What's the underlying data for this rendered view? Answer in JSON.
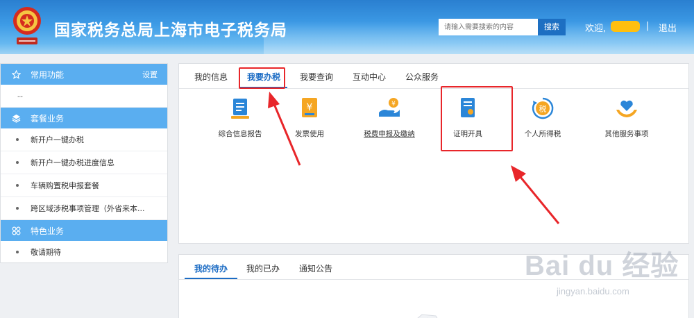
{
  "header": {
    "title": "国家税务总局上海市电子税务局",
    "search_placeholder": "请输入需要搜索的内容",
    "search_label": "搜索",
    "welcome": "欢迎,",
    "separator": "|",
    "logout": "退出"
  },
  "sidebar": {
    "common": {
      "label": "常用功能",
      "setting": "设置",
      "icon": "star-icon"
    },
    "common_empty": "--",
    "package": {
      "label": "套餐业务",
      "icon": "layers-icon"
    },
    "package_items": [
      {
        "label": "新开户一键办税"
      },
      {
        "label": "新开户一键办税进度信息"
      },
      {
        "label": "车辆购置税申报套餐"
      },
      {
        "label": "跨区域涉税事项管理（外省来本..."
      }
    ],
    "special": {
      "label": "特色业务",
      "icon": "grid-icon"
    },
    "special_items": [
      {
        "label": "敬请期待"
      }
    ]
  },
  "main": {
    "tabs": [
      {
        "label": "我的信息"
      },
      {
        "label": "我要办税",
        "active": true
      },
      {
        "label": "我要查询"
      },
      {
        "label": "互动中心"
      },
      {
        "label": "公众服务"
      }
    ],
    "services": [
      {
        "label": "综合信息报告",
        "icon": "report-icon"
      },
      {
        "label": "发票使用",
        "icon": "invoice-icon"
      },
      {
        "label": "税费申报及缴纳",
        "icon": "tax-payment-icon"
      },
      {
        "label": "证明开具",
        "icon": "certificate-icon"
      },
      {
        "label": "个人所得税",
        "icon": "personal-tax-icon"
      },
      {
        "label": "其他服务事项",
        "icon": "heart-hand-icon"
      }
    ]
  },
  "bottom": {
    "tabs": [
      {
        "label": "我的待办",
        "active": true
      },
      {
        "label": "我的已办"
      },
      {
        "label": "通知公告"
      }
    ]
  },
  "watermark": {
    "main": "Bai du 经验",
    "sub": "jingyan.baidu.com"
  },
  "colors": {
    "accent": "#1c6cc4",
    "sidebar_header": "#5aaef0",
    "header_bg": "#3d9be6",
    "highlight": "#e8262a",
    "name_mask": "#ffbf0f"
  }
}
